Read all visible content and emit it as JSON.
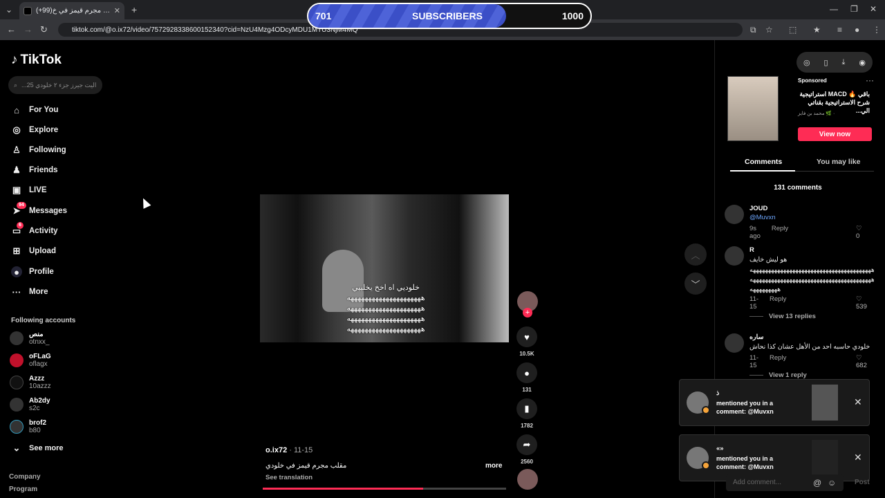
{
  "browser": {
    "tab_title": "مقلب مجرم قيمز في خ(99+)",
    "url": "tiktok.com/@o.ix72/video/7572928338600152340?cid=NzU4Mzg4ODcyMDU1MTU3NjM4MQ"
  },
  "overlay": {
    "current": "701",
    "label": "SUBSCRIBERS",
    "goal": "1000",
    "progress": 0.701
  },
  "sidebar": {
    "logo": "TikTok",
    "search_placeholder": "...اليت جيرز جزء ٢ خلودي 25",
    "nav": [
      {
        "label": "For You",
        "icon": "home-icon"
      },
      {
        "label": "Explore",
        "icon": "compass-icon"
      },
      {
        "label": "Following",
        "icon": "following-icon"
      },
      {
        "label": "Friends",
        "icon": "friends-icon"
      },
      {
        "label": "LIVE",
        "icon": "live-icon"
      },
      {
        "label": "Messages",
        "icon": "messages-icon",
        "badge": "94"
      },
      {
        "label": "Activity",
        "icon": "activity-icon",
        "badge": "6"
      },
      {
        "label": "Upload",
        "icon": "upload-icon"
      },
      {
        "label": "Profile",
        "icon": "profile-icon"
      },
      {
        "label": "More",
        "icon": "more-icon"
      }
    ],
    "following_title": "Following accounts",
    "following": [
      {
        "name": "منص",
        "handle": "otnxx_"
      },
      {
        "name": "oFLaG",
        "handle": "oflagx"
      },
      {
        "name": "Azzz",
        "handle": "10azzz"
      },
      {
        "name": "Ab2dy",
        "handle": "s2c"
      },
      {
        "name": "brof2",
        "handle": "b80"
      }
    ],
    "see_more": "See more",
    "footer": [
      "Company",
      "Program"
    ]
  },
  "video": {
    "caption_lines": [
      "خلوديي اه اخخ يخلييي",
      "هههههههههههههههههههههه",
      "هههههههههههههههههههههه",
      "هههههههههههههههههههههه",
      "هههههههههههههههههههههه"
    ],
    "author": "o.ix72",
    "date": "11-15",
    "description": "مقلب مجرم قيمز في خلودي",
    "more": "more",
    "translate": "See translation",
    "progress": 0.66
  },
  "actions": {
    "likes": "10.5K",
    "comments": "131",
    "saves": "1782",
    "shares": "2560"
  },
  "ad": {
    "sponsored": "Sponsored",
    "title": "باقي 🔥 MACD استراتيجية شرح الاستراتيجية بقناتي الي...",
    "author": "محمد بن فايز 🌿 ·",
    "button": "View now"
  },
  "panel_tabs": [
    "Comments",
    "You may like"
  ],
  "comment_count": "131 comments",
  "comments": [
    {
      "name": "JOUD",
      "lines": [
        "@Muvxn"
      ],
      "time": "9s ago",
      "reply": "Reply",
      "likes": "0"
    },
    {
      "name": "R",
      "lines": [
        "هو ليش خايف",
        "ههههههههههههههههههههههههههههههههههههههههه",
        "ههههههههههههههههههههههههههههههههههههههههه",
        "هههههههههه"
      ],
      "time": "11-15",
      "reply": "Reply",
      "likes": "539",
      "view_replies": "View 13 replies"
    },
    {
      "name": "ساره",
      "lines": [
        "خلودي حاسبه احد من الأهل عشان كذا نحاش"
      ],
      "time": "11-15",
      "reply": "Reply",
      "likes": "682",
      "view_replies": "View 1 reply"
    }
  ],
  "notifications": [
    {
      "name": "ذ",
      "text": "mentioned you in a comment: @Muvxn"
    },
    {
      "name": "«»",
      "text": "mentioned you in a comment: @Muvxn"
    }
  ],
  "comment_input": {
    "placeholder": "Add comment...",
    "post": "Post"
  },
  "colors": {
    "accent": "#fe2c55",
    "overlay_fill": "#3b4fc7"
  }
}
